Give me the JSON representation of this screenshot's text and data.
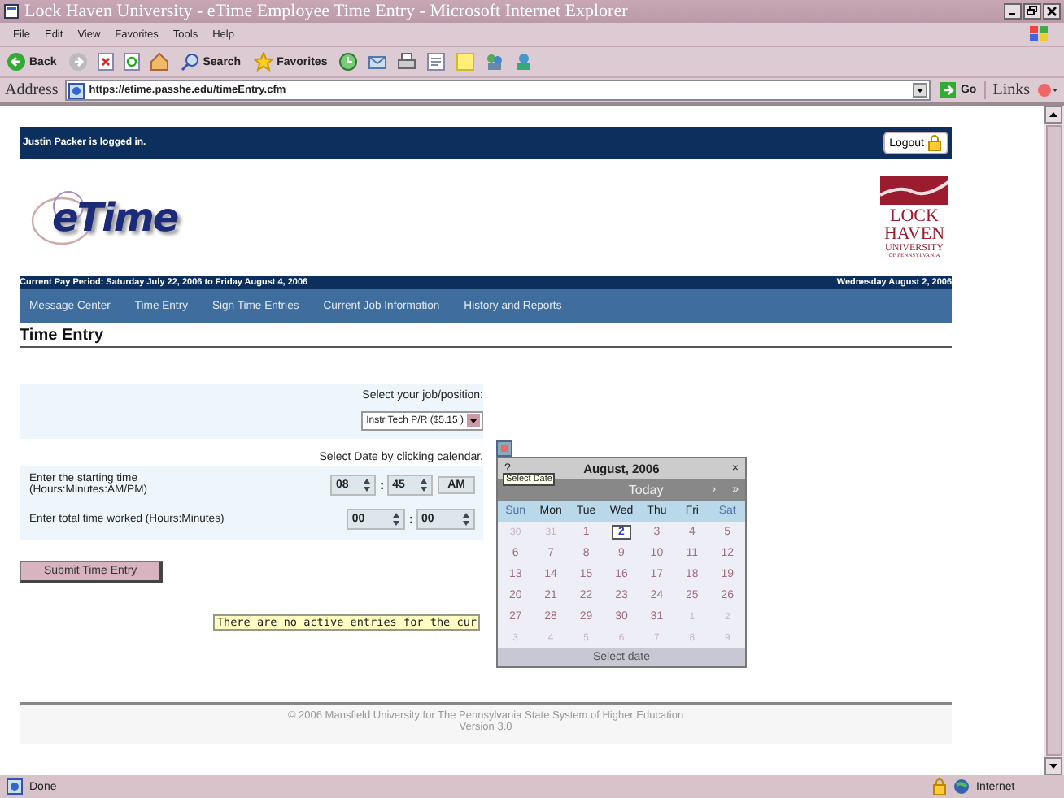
{
  "window": {
    "title": "Lock Haven University - eTime Employee Time Entry - Microsoft Internet Explorer"
  },
  "menu": [
    "File",
    "Edit",
    "View",
    "Favorites",
    "Tools",
    "Help"
  ],
  "toolbar": {
    "back": "Back",
    "search": "Search",
    "favorites": "Favorites"
  },
  "address": {
    "label": "Address",
    "url": "https://etime.passhe.edu/timeEntry.cfm",
    "go": "Go",
    "links": "Links"
  },
  "user_bar": {
    "text": "Justin Packer is logged in.",
    "logout": "Logout"
  },
  "logo": "eTime",
  "university_logo": [
    "LOCK",
    "HAVEN",
    "UNIVERSITY",
    "OF PENNSYLVANIA"
  ],
  "pay_period": "Current Pay Period: Saturday July 22, 2006 to Friday August 4, 2006",
  "today": "Wednesday August 2, 2006",
  "nav": [
    "Message Center",
    "Time Entry",
    "Sign Time Entries",
    "Current Job Information",
    "History and Reports"
  ],
  "heading": "Time Entry",
  "form": {
    "job_label": "Select your job/position:",
    "job_value": "Instr Tech P/R ($5.15 )",
    "date_label": "Select Date by clicking calendar.",
    "start_label": "Enter the starting time",
    "start_hint": "(Hours:Minutes:AM/PM)",
    "separator": ":",
    "start": {
      "hours": "08",
      "minutes": "45",
      "ampm": "AM"
    },
    "total_label": "Enter total time worked (Hours:Minutes)",
    "total": {
      "hours": "00",
      "minutes": "00"
    },
    "submit": "Submit Time Entry",
    "message": "There are no active entries for the cur"
  },
  "calendar": {
    "help": "?",
    "title": "August, 2006",
    "close": "×",
    "tooltip": "Select Date",
    "nav": [
      "Today",
      "›",
      "»"
    ],
    "weekdays": [
      {
        "label": "Sun",
        "weekend": true
      },
      {
        "label": "Mon",
        "weekend": false
      },
      {
        "label": "Tue",
        "weekend": false
      },
      {
        "label": "Wed",
        "weekend": false
      },
      {
        "label": "Thu",
        "weekend": false
      },
      {
        "label": "Fri",
        "weekend": false
      },
      {
        "label": "Sat",
        "weekend": true
      }
    ],
    "weeks": [
      [
        {
          "day": "30",
          "other": true,
          "selected": false
        },
        {
          "day": "31",
          "other": true,
          "selected": false
        },
        {
          "day": "1",
          "other": false,
          "selected": false
        },
        {
          "day": "2",
          "other": false,
          "selected": true
        },
        {
          "day": "3",
          "other": false,
          "selected": false
        },
        {
          "day": "4",
          "other": false,
          "selected": false
        },
        {
          "day": "5",
          "other": false,
          "selected": false
        }
      ],
      [
        {
          "day": "6",
          "other": false,
          "selected": false
        },
        {
          "day": "7",
          "other": false,
          "selected": false
        },
        {
          "day": "8",
          "other": false,
          "selected": false
        },
        {
          "day": "9",
          "other": false,
          "selected": false
        },
        {
          "day": "10",
          "other": false,
          "selected": false
        },
        {
          "day": "11",
          "other": false,
          "selected": false
        },
        {
          "day": "12",
          "other": false,
          "selected": false
        }
      ],
      [
        {
          "day": "13",
          "other": false,
          "selected": false
        },
        {
          "day": "14",
          "other": false,
          "selected": false
        },
        {
          "day": "15",
          "other": false,
          "selected": false
        },
        {
          "day": "16",
          "other": false,
          "selected": false
        },
        {
          "day": "17",
          "other": false,
          "selected": false
        },
        {
          "day": "18",
          "other": false,
          "selected": false
        },
        {
          "day": "19",
          "other": false,
          "selected": false
        }
      ],
      [
        {
          "day": "20",
          "other": false,
          "selected": false
        },
        {
          "day": "21",
          "other": false,
          "selected": false
        },
        {
          "day": "22",
          "other": false,
          "selected": false
        },
        {
          "day": "23",
          "other": false,
          "selected": false
        },
        {
          "day": "24",
          "other": false,
          "selected": false
        },
        {
          "day": "25",
          "other": false,
          "selected": false
        },
        {
          "day": "26",
          "other": false,
          "selected": false
        }
      ],
      [
        {
          "day": "27",
          "other": false,
          "selected": false
        },
        {
          "day": "28",
          "other": false,
          "selected": false
        },
        {
          "day": "29",
          "other": false,
          "selected": false
        },
        {
          "day": "30",
          "other": false,
          "selected": false
        },
        {
          "day": "31",
          "other": false,
          "selected": false
        },
        {
          "day": "1",
          "other": true,
          "selected": false
        },
        {
          "day": "2",
          "other": true,
          "selected": false
        }
      ],
      [
        {
          "day": "3",
          "other": true,
          "selected": false
        },
        {
          "day": "4",
          "other": true,
          "selected": false
        },
        {
          "day": "5",
          "other": true,
          "selected": false
        },
        {
          "day": "6",
          "other": true,
          "selected": false
        },
        {
          "day": "7",
          "other": true,
          "selected": false
        },
        {
          "day": "8",
          "other": true,
          "selected": false
        },
        {
          "day": "9",
          "other": true,
          "selected": false
        }
      ]
    ],
    "footer": "Select date"
  },
  "footer": [
    "© 2006 Mansfield University for The Pennsylvania State System of Higher Education",
    "Version 3.0"
  ],
  "status_bar": {
    "text": "Done",
    "zone": "Internet"
  }
}
